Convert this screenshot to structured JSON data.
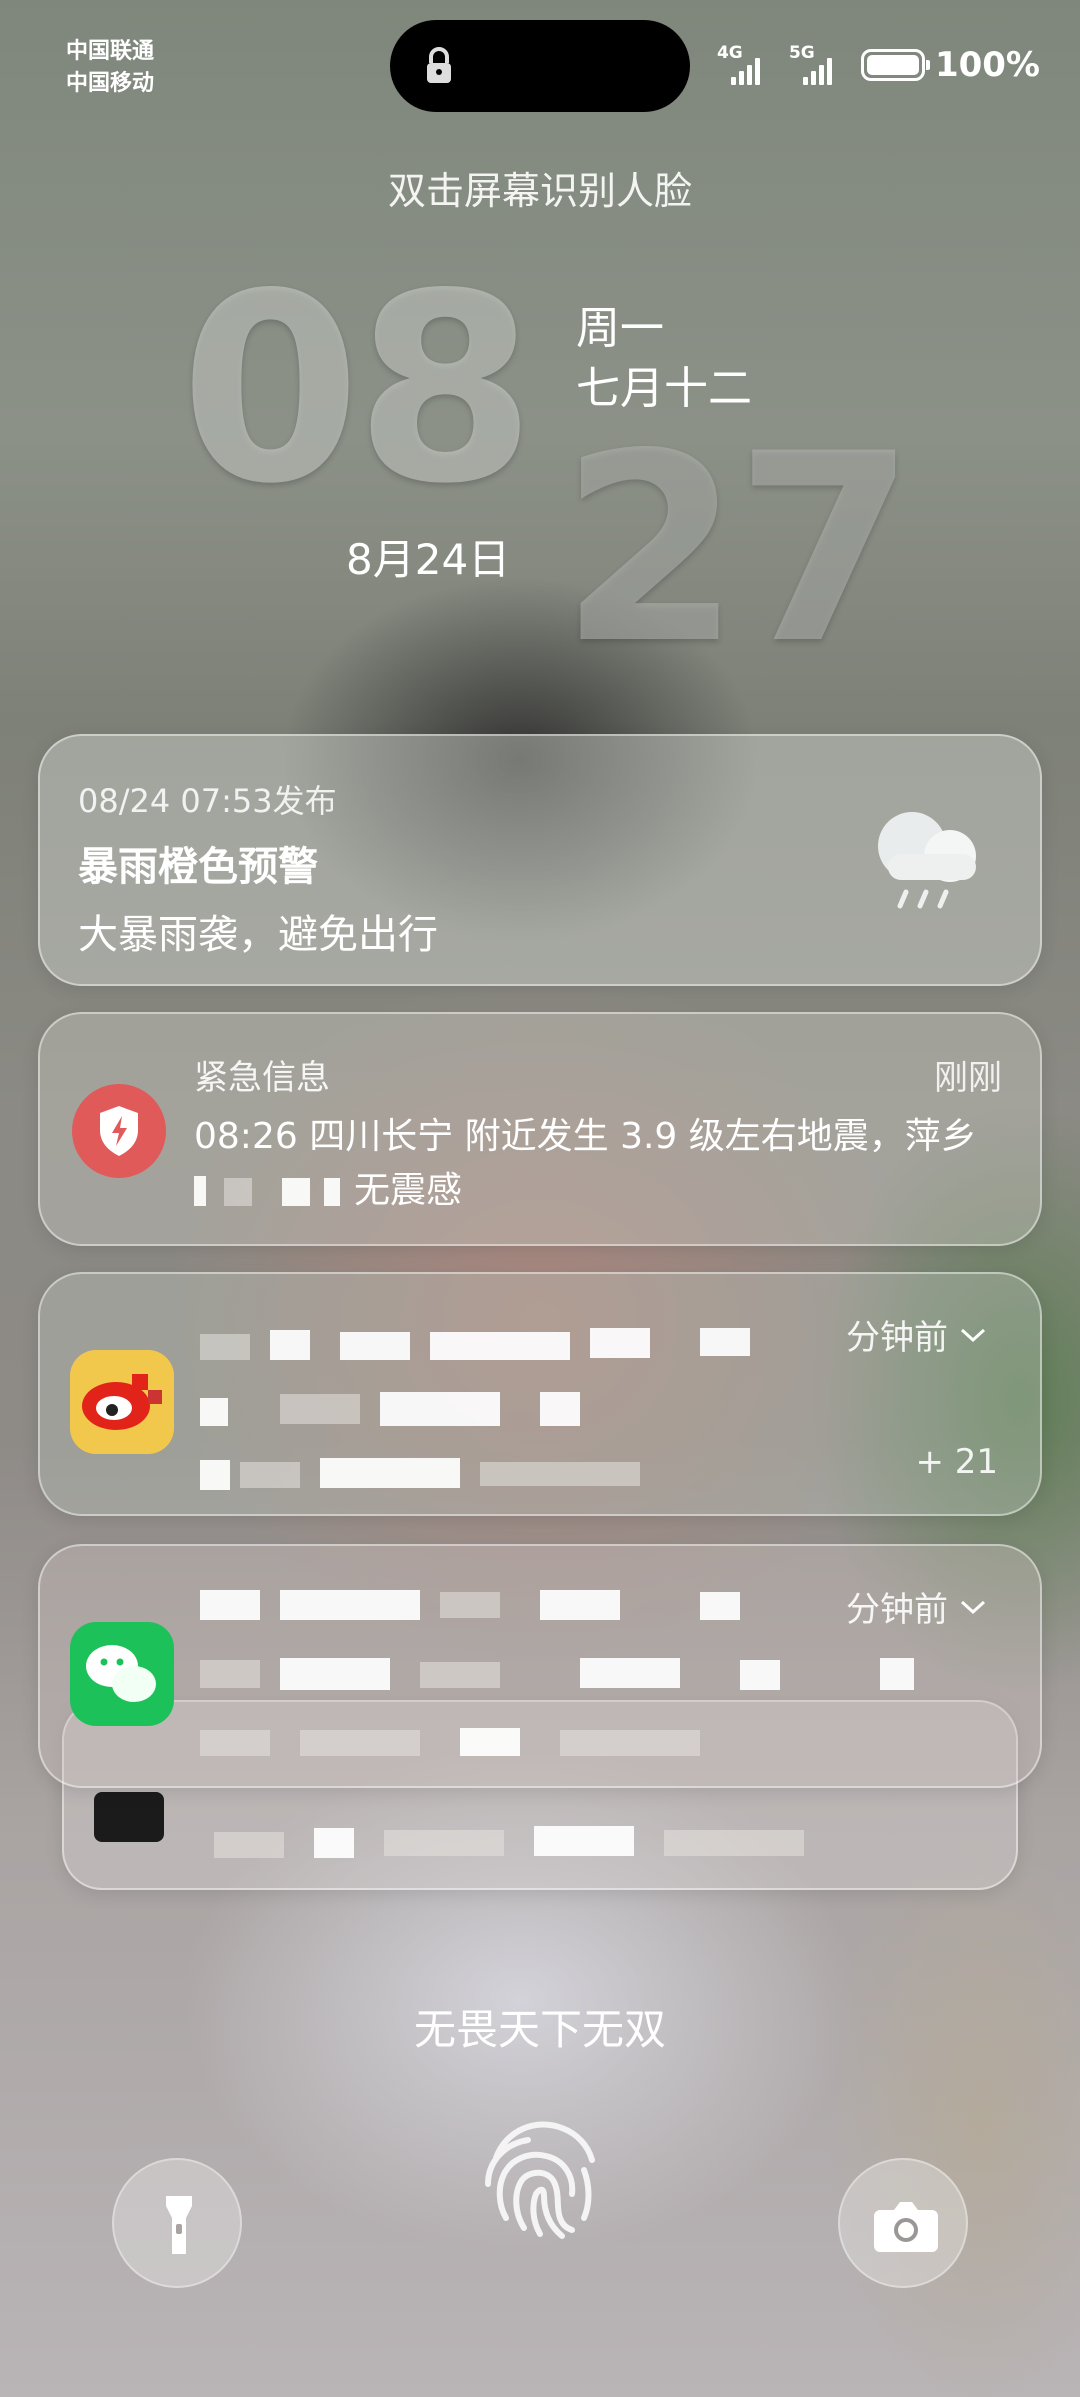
{
  "status_bar": {
    "carrier_1": "中国联通",
    "carrier_2": "中国移动",
    "network_1": "4G",
    "network_2": "5G",
    "battery": "100%",
    "lock_icon": "lock-icon"
  },
  "face_hint": "双击屏幕识别人脸",
  "clock": {
    "hour": "08",
    "minute": "27",
    "weekday": "周一",
    "lunar_date": "七月十二",
    "date": "8月24日"
  },
  "notifications": {
    "weather_alert": {
      "time": "08/24 07:53发布",
      "title": "暴雨橙色预警",
      "body": "大暴雨袭，避免出行",
      "icon": "rain-cloud-icon"
    },
    "emergency": {
      "app": "紧急信息",
      "time": "刚刚",
      "body": "08:26 四川长宁 附近发生 3.9 级左右地震，萍乡",
      "body_tail": "无震感",
      "icon": "shield-bolt-icon"
    },
    "weibo": {
      "time": "分钟前",
      "more_count": "+ 21",
      "icon": "weibo-icon"
    },
    "wechat": {
      "time": "分钟前",
      "icon": "wechat-icon"
    }
  },
  "slogan": "无畏天下无双",
  "bottom": {
    "left_icon": "flashlight-icon",
    "center_icon": "fingerprint-icon",
    "right_icon": "camera-icon"
  }
}
